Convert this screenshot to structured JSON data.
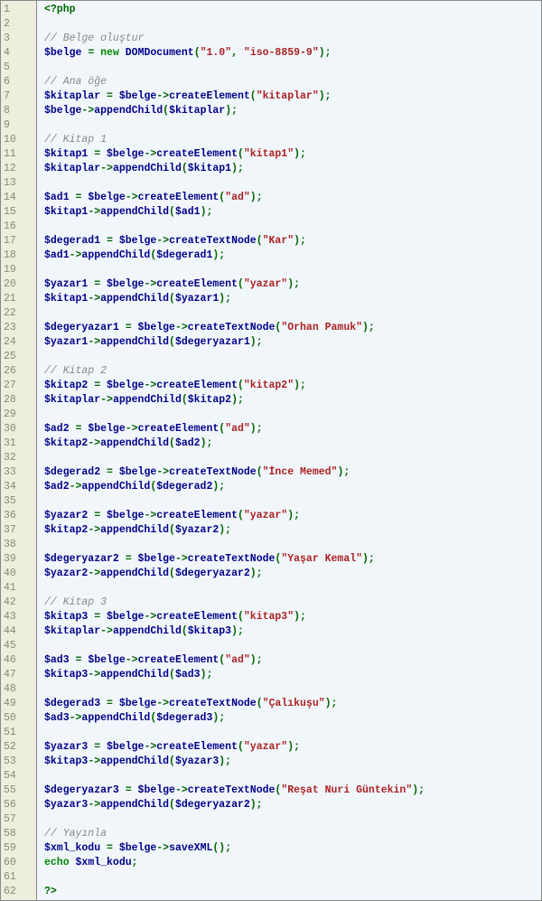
{
  "code": {
    "language": "php",
    "lines": [
      {
        "t": "tag",
        "s": "<?php"
      },
      {
        "t": "blank"
      },
      {
        "t": "comment",
        "s": "// Belge oluştur"
      },
      {
        "t": "assign_new",
        "v": "$belge",
        "cls": "DOMDocument",
        "args": [
          "\"1.0\"",
          "\"iso-8859-9\""
        ]
      },
      {
        "t": "blank"
      },
      {
        "t": "comment",
        "s": "// Ana öğe"
      },
      {
        "t": "assign_call",
        "v": "$kitaplar",
        "obj": "$belge",
        "m": "createElement",
        "args": [
          "\"kitaplar\""
        ]
      },
      {
        "t": "call",
        "obj": "$belge",
        "m": "appendChild",
        "args": [
          "$kitaplar"
        ]
      },
      {
        "t": "blank"
      },
      {
        "t": "comment",
        "s": "// Kitap 1"
      },
      {
        "t": "assign_call",
        "v": "$kitap1",
        "obj": "$belge",
        "m": "createElement",
        "args": [
          "\"kitap1\""
        ]
      },
      {
        "t": "call",
        "obj": "$kitaplar",
        "m": "appendChild",
        "args": [
          "$kitap1"
        ]
      },
      {
        "t": "blank"
      },
      {
        "t": "assign_call",
        "v": "$ad1",
        "obj": "$belge",
        "m": "createElement",
        "args": [
          "\"ad\""
        ]
      },
      {
        "t": "call",
        "obj": "$kitap1",
        "m": "appendChild",
        "args": [
          "$ad1"
        ]
      },
      {
        "t": "blank"
      },
      {
        "t": "assign_call",
        "v": "$degerad1",
        "obj": "$belge",
        "m": "createTextNode",
        "args": [
          "\"Kar\""
        ]
      },
      {
        "t": "call",
        "obj": "$ad1",
        "m": "appendChild",
        "args": [
          "$degerad1"
        ]
      },
      {
        "t": "blank"
      },
      {
        "t": "assign_call",
        "v": "$yazar1",
        "obj": "$belge",
        "m": "createElement",
        "args": [
          "\"yazar\""
        ]
      },
      {
        "t": "call",
        "obj": "$kitap1",
        "m": "appendChild",
        "args": [
          "$yazar1"
        ]
      },
      {
        "t": "blank"
      },
      {
        "t": "assign_call",
        "v": "$degeryazar1",
        "obj": "$belge",
        "m": "createTextNode",
        "args": [
          "\"Orhan Pamuk\""
        ]
      },
      {
        "t": "call",
        "obj": "$yazar1",
        "m": "appendChild",
        "args": [
          "$degeryazar1"
        ]
      },
      {
        "t": "blank"
      },
      {
        "t": "comment",
        "s": "// Kitap 2"
      },
      {
        "t": "assign_call",
        "v": "$kitap2",
        "obj": "$belge",
        "m": "createElement",
        "args": [
          "\"kitap2\""
        ]
      },
      {
        "t": "call",
        "obj": "$kitaplar",
        "m": "appendChild",
        "args": [
          "$kitap2"
        ]
      },
      {
        "t": "blank"
      },
      {
        "t": "assign_call",
        "v": "$ad2",
        "obj": "$belge",
        "m": "createElement",
        "args": [
          "\"ad\""
        ]
      },
      {
        "t": "call",
        "obj": "$kitap2",
        "m": "appendChild",
        "args": [
          "$ad2"
        ]
      },
      {
        "t": "blank"
      },
      {
        "t": "assign_call",
        "v": "$degerad2",
        "obj": "$belge",
        "m": "createTextNode",
        "args": [
          "\"İnce Memed\""
        ]
      },
      {
        "t": "call",
        "obj": "$ad2",
        "m": "appendChild",
        "args": [
          "$degerad2"
        ]
      },
      {
        "t": "blank"
      },
      {
        "t": "assign_call",
        "v": "$yazar2",
        "obj": "$belge",
        "m": "createElement",
        "args": [
          "\"yazar\""
        ]
      },
      {
        "t": "call",
        "obj": "$kitap2",
        "m": "appendChild",
        "args": [
          "$yazar2"
        ]
      },
      {
        "t": "blank"
      },
      {
        "t": "assign_call",
        "v": "$degeryazar2",
        "obj": "$belge",
        "m": "createTextNode",
        "args": [
          "\"Yaşar Kemal\""
        ]
      },
      {
        "t": "call",
        "obj": "$yazar2",
        "m": "appendChild",
        "args": [
          "$degeryazar2"
        ]
      },
      {
        "t": "blank"
      },
      {
        "t": "comment",
        "s": "// Kitap 3"
      },
      {
        "t": "assign_call",
        "v": "$kitap3",
        "obj": "$belge",
        "m": "createElement",
        "args": [
          "\"kitap3\""
        ]
      },
      {
        "t": "call",
        "obj": "$kitaplar",
        "m": "appendChild",
        "args": [
          "$kitap3"
        ]
      },
      {
        "t": "blank"
      },
      {
        "t": "assign_call",
        "v": "$ad3",
        "obj": "$belge",
        "m": "createElement",
        "args": [
          "\"ad\""
        ]
      },
      {
        "t": "call",
        "obj": "$kitap3",
        "m": "appendChild",
        "args": [
          "$ad3"
        ]
      },
      {
        "t": "blank"
      },
      {
        "t": "assign_call",
        "v": "$degerad3",
        "obj": "$belge",
        "m": "createTextNode",
        "args": [
          "\"Çalıkuşu\""
        ]
      },
      {
        "t": "call",
        "obj": "$ad3",
        "m": "appendChild",
        "args": [
          "$degerad3"
        ]
      },
      {
        "t": "blank"
      },
      {
        "t": "assign_call",
        "v": "$yazar3",
        "obj": "$belge",
        "m": "createElement",
        "args": [
          "\"yazar\""
        ]
      },
      {
        "t": "call",
        "obj": "$kitap3",
        "m": "appendChild",
        "args": [
          "$yazar3"
        ]
      },
      {
        "t": "blank"
      },
      {
        "t": "assign_call",
        "v": "$degeryazar3",
        "obj": "$belge",
        "m": "createTextNode",
        "args": [
          "\"Reşat Nuri Güntekin\""
        ]
      },
      {
        "t": "call",
        "obj": "$yazar3",
        "m": "appendChild",
        "args": [
          "$degeryazar2"
        ]
      },
      {
        "t": "blank"
      },
      {
        "t": "comment",
        "s": "// Yayınla"
      },
      {
        "t": "assign_call",
        "v": "$xml_kodu",
        "obj": "$belge",
        "m": "saveXML",
        "args": []
      },
      {
        "t": "echo",
        "v": "$xml_kodu"
      },
      {
        "t": "blank"
      },
      {
        "t": "tag",
        "s": "?>"
      }
    ]
  }
}
